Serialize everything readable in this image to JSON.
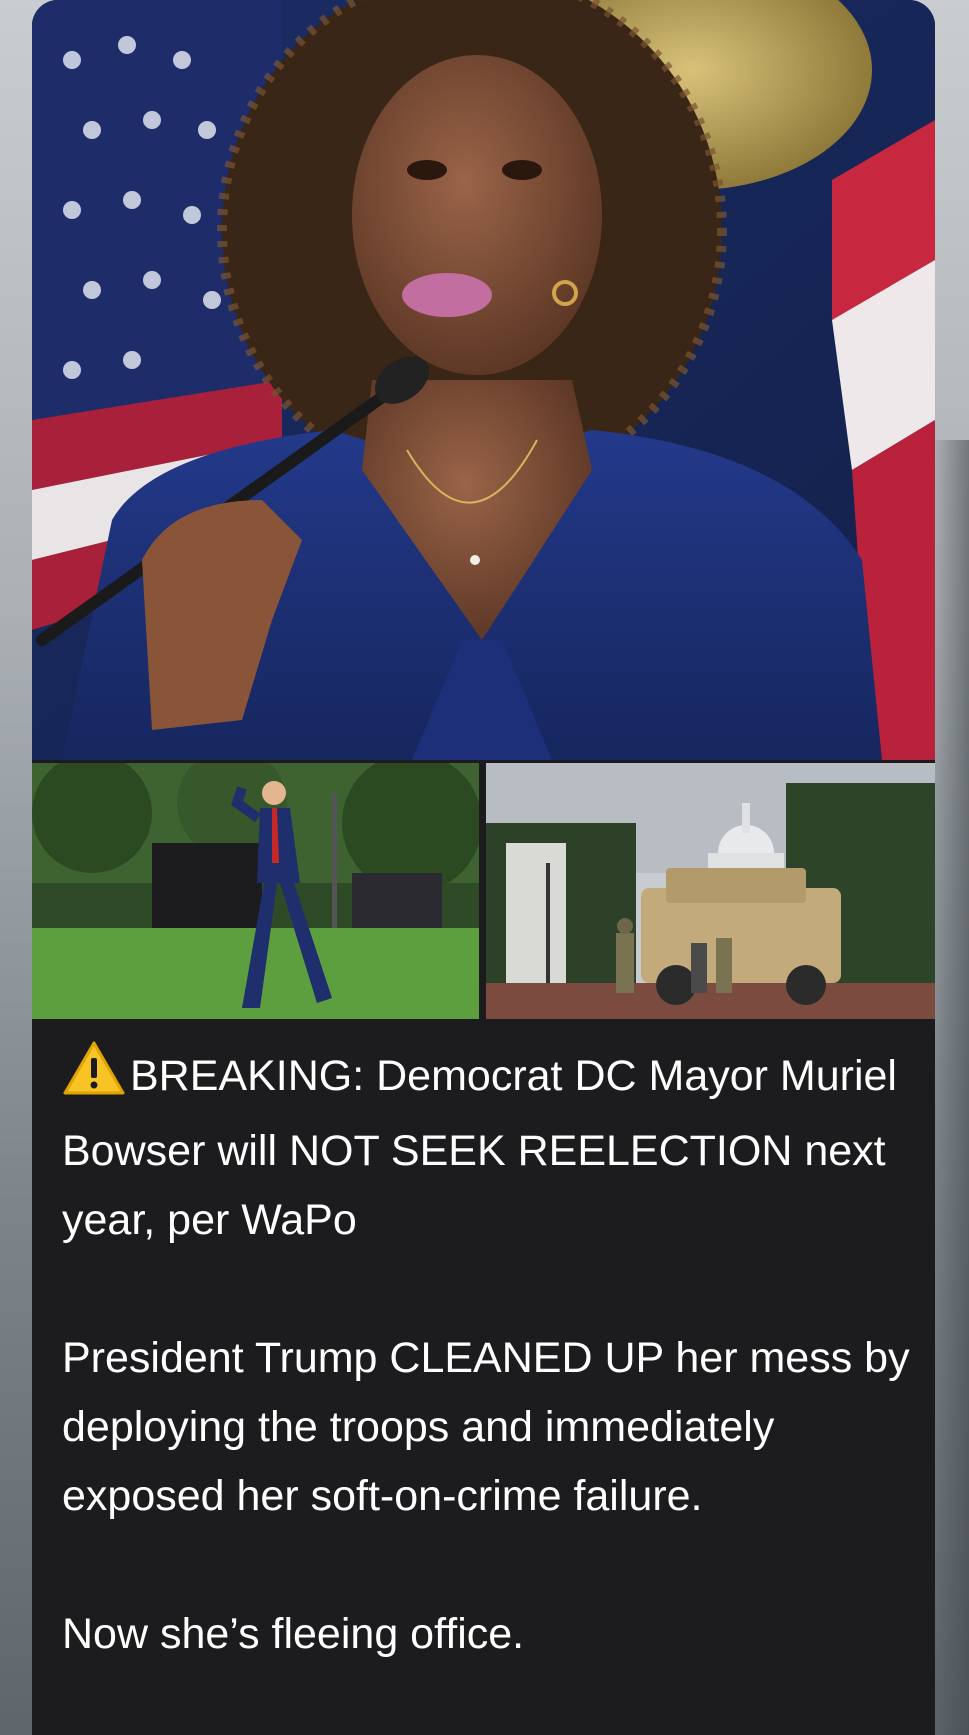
{
  "post": {
    "warning_icon": "warning-icon",
    "headline": "BREAKING: Democrat DC Mayor Muriel Bowser will NOT SEEK REELECTION next year, per WaPo",
    "paragraph_2": "President Trump CLEANED UP her mess by deploying the troops and immediately exposed her soft-on-crime failure.",
    "paragraph_3": "Now she’s fleeing office."
  },
  "colors": {
    "card_background": "#1c1c1e",
    "text": "#ffffff",
    "warning_yellow": "#f7c325"
  }
}
